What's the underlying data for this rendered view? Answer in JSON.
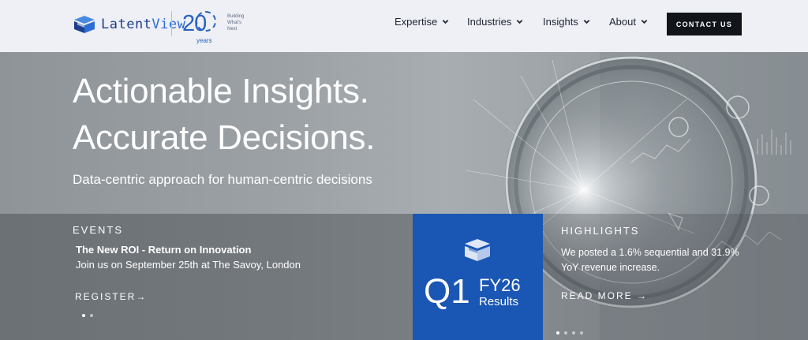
{
  "brand": {
    "logo_text_a": "Latent",
    "logo_text_b": "View",
    "anniversary_number": "20",
    "anniversary_years": "years",
    "tagline": [
      "Building",
      "What's",
      "Next"
    ]
  },
  "nav": {
    "items": [
      {
        "label": "Expertise",
        "icon": "chevron-down-icon"
      },
      {
        "label": "Industries",
        "icon": "chevron-down-icon"
      },
      {
        "label": "Insights",
        "icon": "chevron-down-icon"
      },
      {
        "label": "About",
        "icon": "chevron-down-icon"
      }
    ],
    "cta": "CONTACT US"
  },
  "hero": {
    "line1": "Actionable Insights.",
    "line2": "Accurate Decisions.",
    "subhead": "Data-centric approach for human-centric decisions"
  },
  "events": {
    "title": "EVENTS",
    "name": "The New ROI - Return on Innovation",
    "desc": "Join us on September 25th at The Savoy, London",
    "link": "REGISTER→",
    "slides": 2,
    "active_slide": 1
  },
  "q1": {
    "big": "Q1",
    "fy": "FY26",
    "results": "Results",
    "color": "#1a56b4"
  },
  "highlights": {
    "title": "HIGHLIGHTS",
    "body": "We posted a 1.6% sequential and 31.9% YoY revenue increase.",
    "link": "READ MORE →",
    "slides": 4,
    "active_slide": 1
  },
  "colors": {
    "brand_blue": "#2b62c0",
    "cta_bg": "#111418",
    "header_bg": "#eef0f6"
  }
}
